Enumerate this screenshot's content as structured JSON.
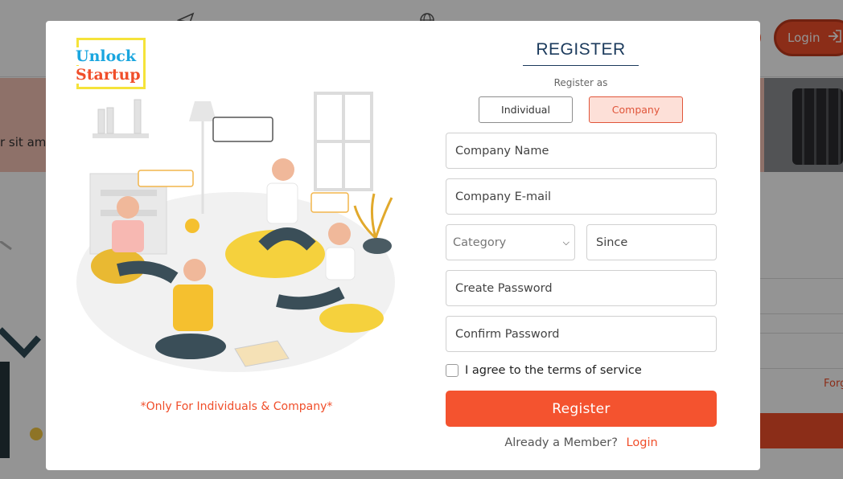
{
  "background": {
    "banner_text": "r sit ame",
    "login_label": "Login",
    "forgot_text": "Forg"
  },
  "modal": {
    "logo": {
      "line1": "Unlock",
      "line2": "Startup"
    },
    "caption": "*Only For Individuals & Company*",
    "form": {
      "title": "REGISTER",
      "register_as_label": "Register as",
      "roles": [
        {
          "label": "Individual",
          "selected": false
        },
        {
          "label": "Company",
          "selected": true
        }
      ],
      "fields": {
        "company_name": {
          "placeholder": "Company Name"
        },
        "company_email": {
          "placeholder": "Company E-mail"
        },
        "category": {
          "selected": "Category"
        },
        "since": {
          "placeholder": "Since"
        },
        "password": {
          "placeholder": "Create Password"
        },
        "confirm_password": {
          "placeholder": "Confirm Password"
        }
      },
      "terms_label": "I agree to the terms of service",
      "register_label": "Register",
      "member_text": "Already a Member?",
      "login_link": "Login"
    }
  },
  "colors": {
    "accent": "#f4532f",
    "title": "#1b3a5c",
    "logo_blue": "#1aa6df",
    "logo_frame": "#f5e33a"
  }
}
